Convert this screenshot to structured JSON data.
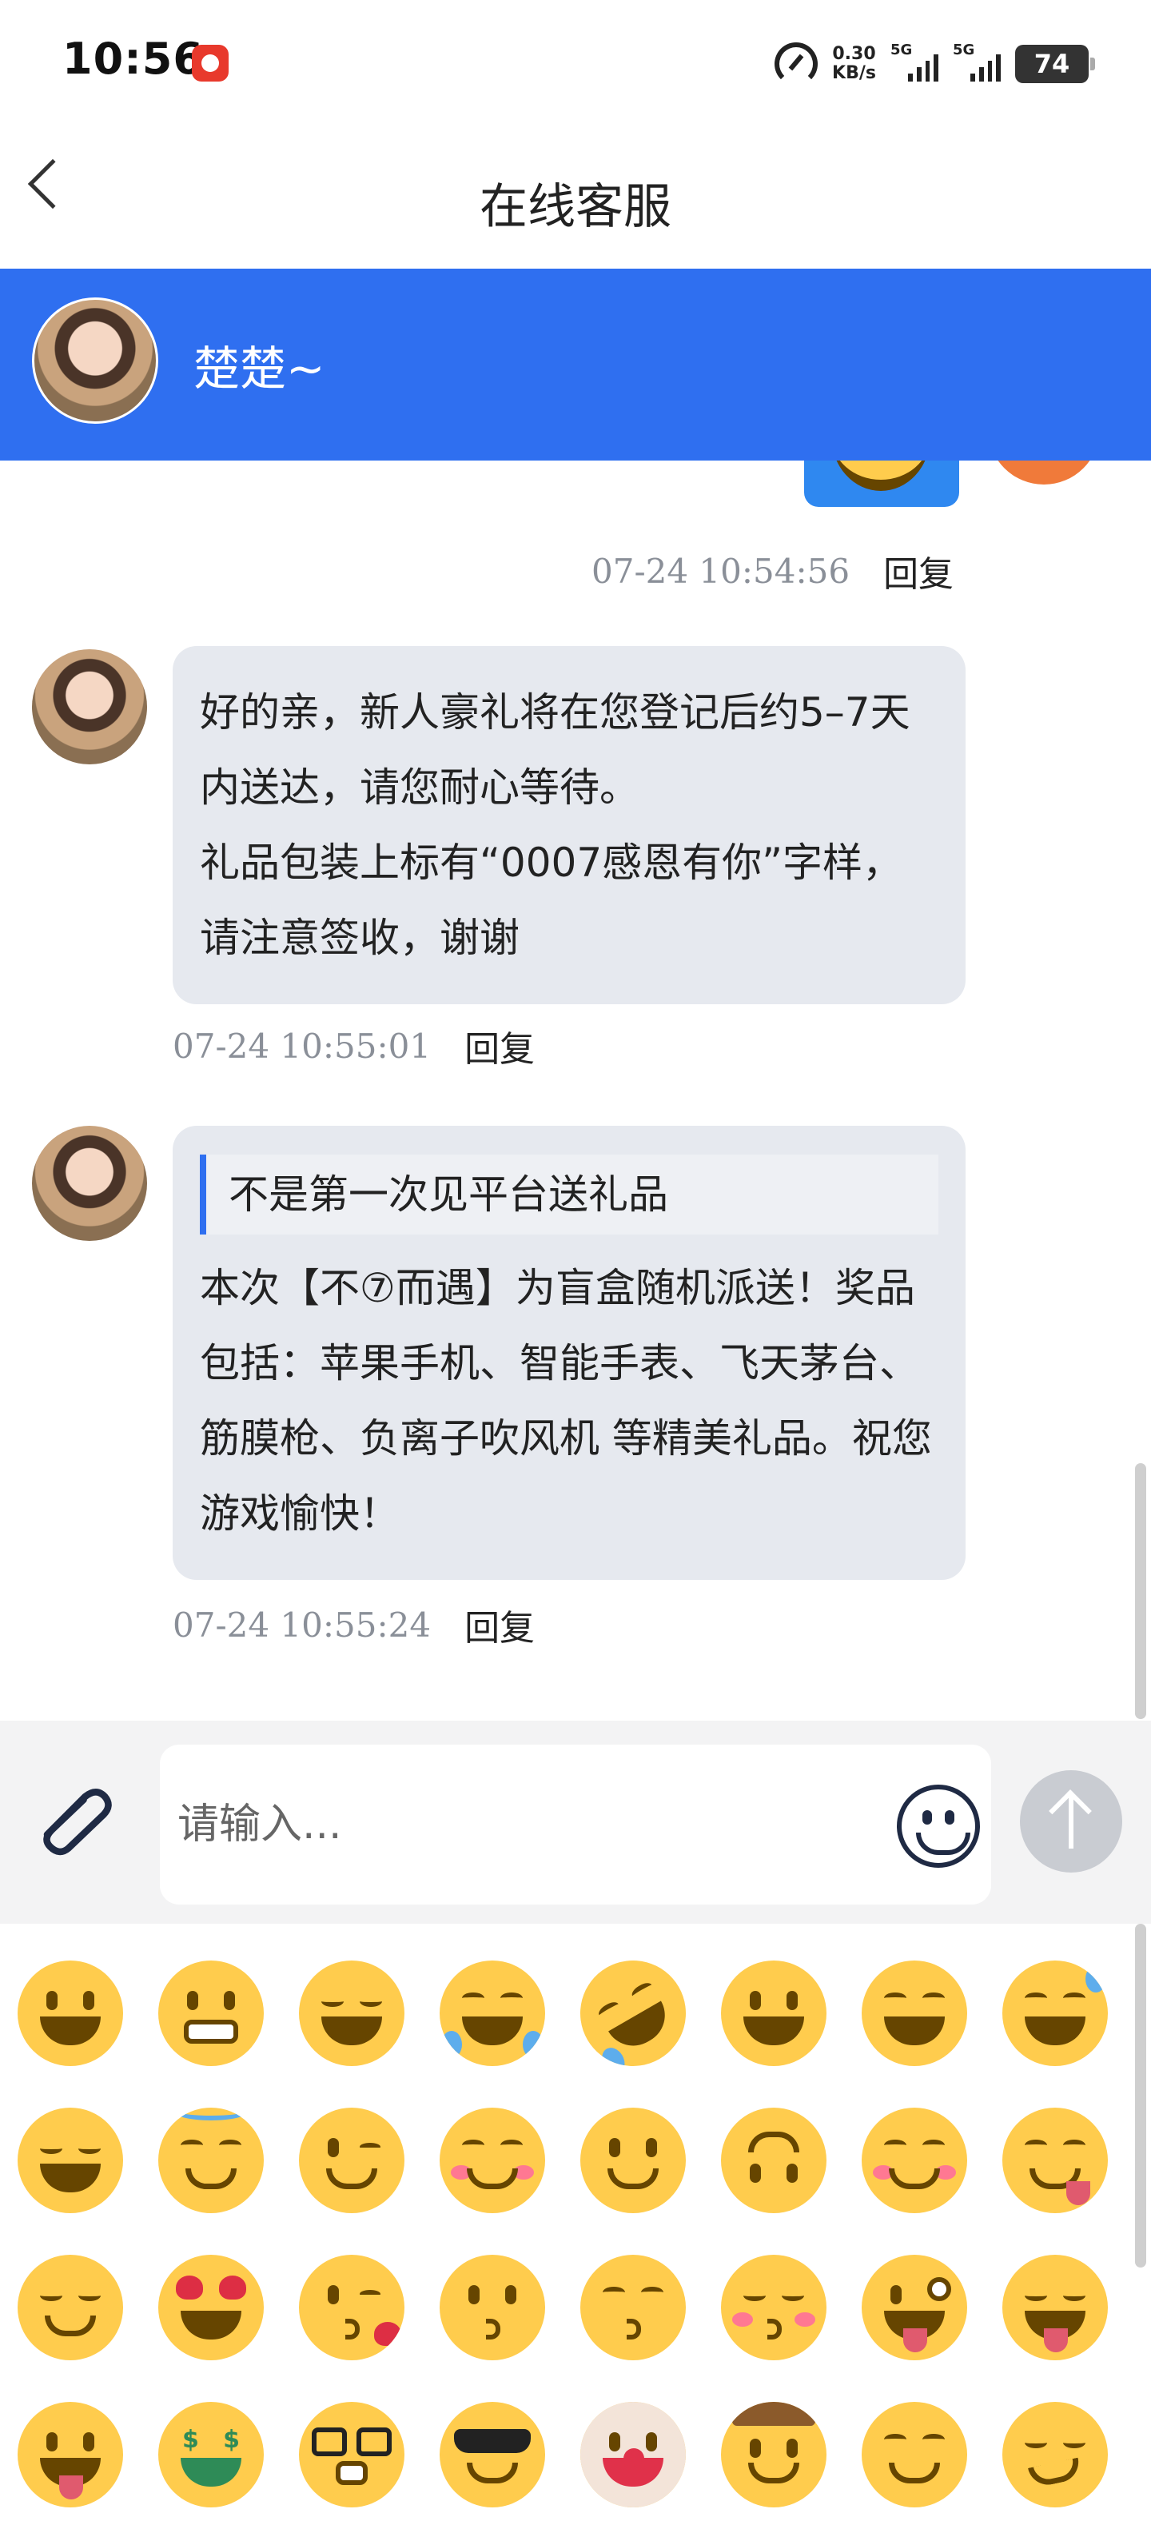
{
  "status_bar": {
    "time": "10:56",
    "net_speed_value": "0.30",
    "net_speed_unit": "KB/s",
    "signal1_label": "5G",
    "signal2_label": "5G",
    "battery": "74"
  },
  "nav": {
    "title": "在线客服"
  },
  "agent": {
    "name": "楚楚~"
  },
  "messages": [
    {
      "time": "07-24 10:54:56",
      "reply": "回复"
    },
    {
      "lines": [
        "好的亲，新人豪礼将在您登记后约5–7天内送达，请您耐心等待。",
        "礼品包装上标有“0007感恩有你”字样，请注意签收，谢谢"
      ],
      "time": "07-24 10:55:01",
      "reply": "回复"
    },
    {
      "quote": "不是第一次见平台送礼品",
      "body": "本次【不⑦而遇】为盲盒随机派送！奖品包括：苹果手机、智能手表、飞天茅台、筋膜枪、负离子吹风机 等精美礼品。祝您游戏愉快！",
      "time": "07-24 10:55:24",
      "reply": "回复"
    }
  ],
  "input": {
    "placeholder": "请输入..."
  },
  "emoji_panel": {
    "emojis": [
      "grinning-face",
      "grimacing-face",
      "beaming-face",
      "face-with-tears-of-joy",
      "rolling-on-floor-laughing",
      "grinning-face-big-eyes",
      "grinning-smiling-eyes",
      "grinning-sweat",
      "squinting-laughing",
      "smiling-halo",
      "winking-face",
      "smiling-blush",
      "slightly-smiling",
      "upside-down-face",
      "smiling-relaxed",
      "face-savoring-food",
      "relieved-face",
      "heart-eyes",
      "face-blowing-kiss",
      "kissing-face",
      "kissing-smiling-eyes",
      "kissing-closed-eyes",
      "zany-face",
      "squinting-tongue",
      "face-with-tongue",
      "money-mouth-face",
      "nerd-face",
      "sunglasses-face",
      "clown-face",
      "cowboy-hat-face",
      "hugging-face",
      "smirking-face"
    ]
  },
  "colors": {
    "brand_blue": "#2f6ff0",
    "bubble_gray": "#e6e9ef",
    "emoji_yellow": "#ffcc4d"
  }
}
